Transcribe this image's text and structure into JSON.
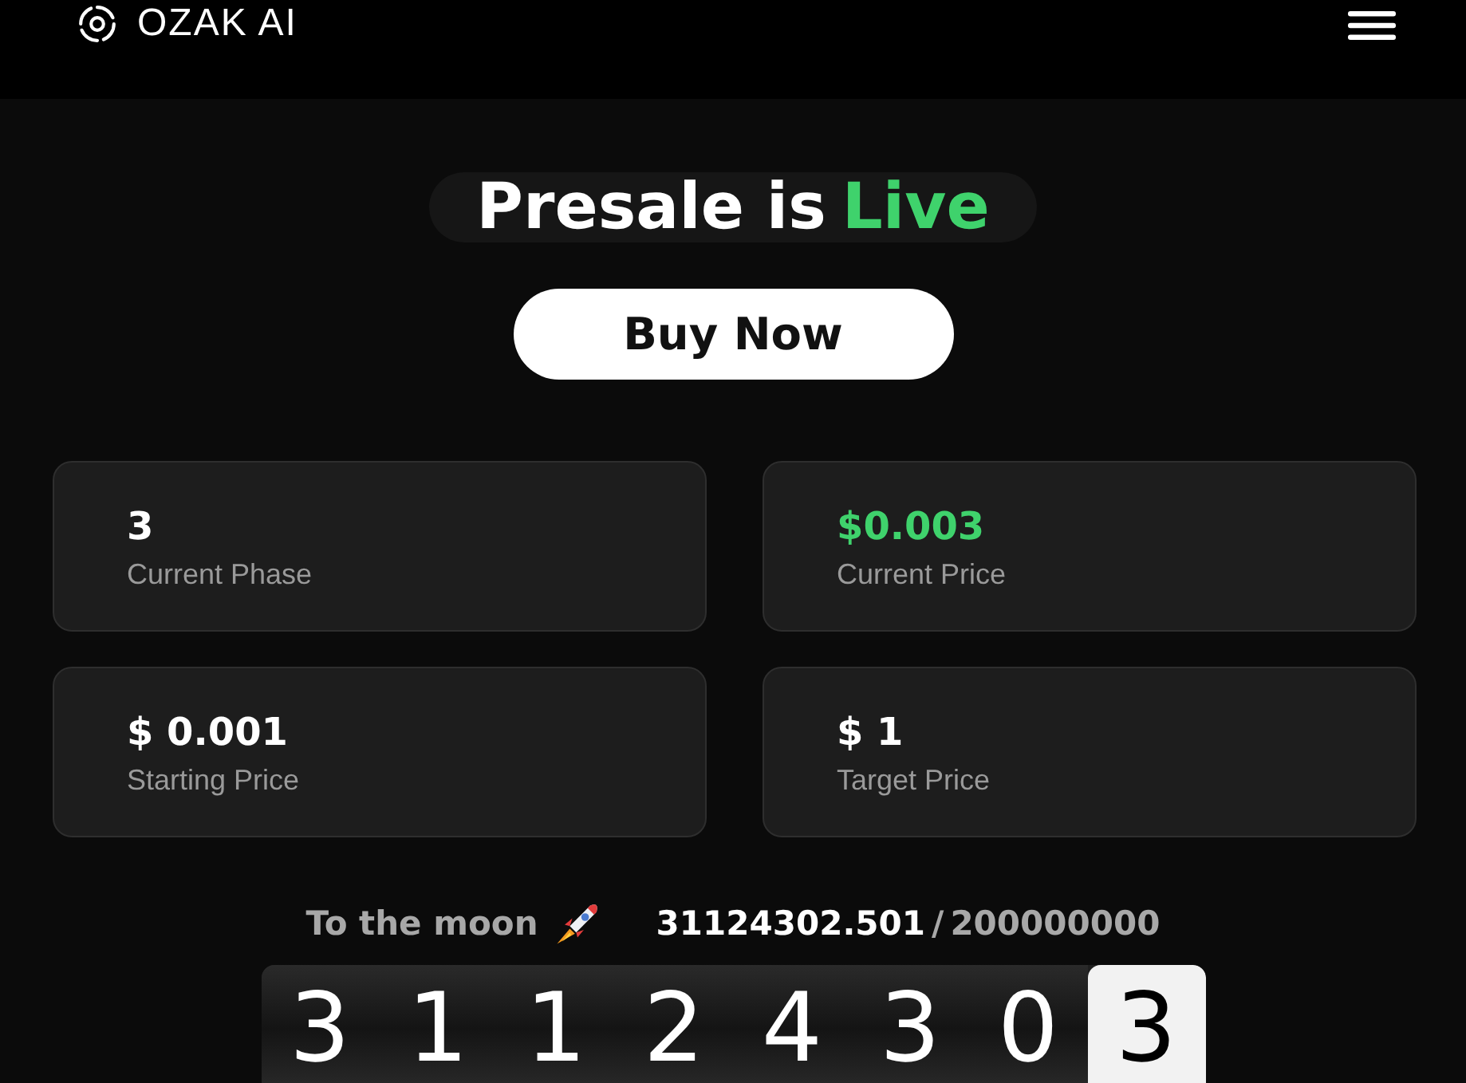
{
  "header": {
    "brand": "OZAK AI"
  },
  "hero": {
    "title": "Presale is",
    "title_accent": "Live",
    "button": "Buy Now"
  },
  "stats": [
    {
      "value": "3",
      "label": "Current Phase",
      "highlight": false
    },
    {
      "value": "$0.003",
      "label": "Current Price",
      "highlight": true
    },
    {
      "value": "$ 0.001",
      "label": "Starting Price",
      "highlight": false
    },
    {
      "value": "$ 1",
      "label": "Target Price",
      "highlight": false
    }
  ],
  "progress": {
    "label": "To the moon",
    "sold": "31124302.501",
    "separator": "/",
    "total": "200000000"
  },
  "counter": [
    {
      "digit": "3",
      "selected": false
    },
    {
      "digit": "1",
      "selected": false
    },
    {
      "digit": "1",
      "selected": false
    },
    {
      "digit": "2",
      "selected": false
    },
    {
      "digit": "4",
      "selected": false
    },
    {
      "digit": "3",
      "selected": false
    },
    {
      "digit": "0",
      "selected": false
    },
    {
      "digit": "3",
      "selected": true
    }
  ]
}
